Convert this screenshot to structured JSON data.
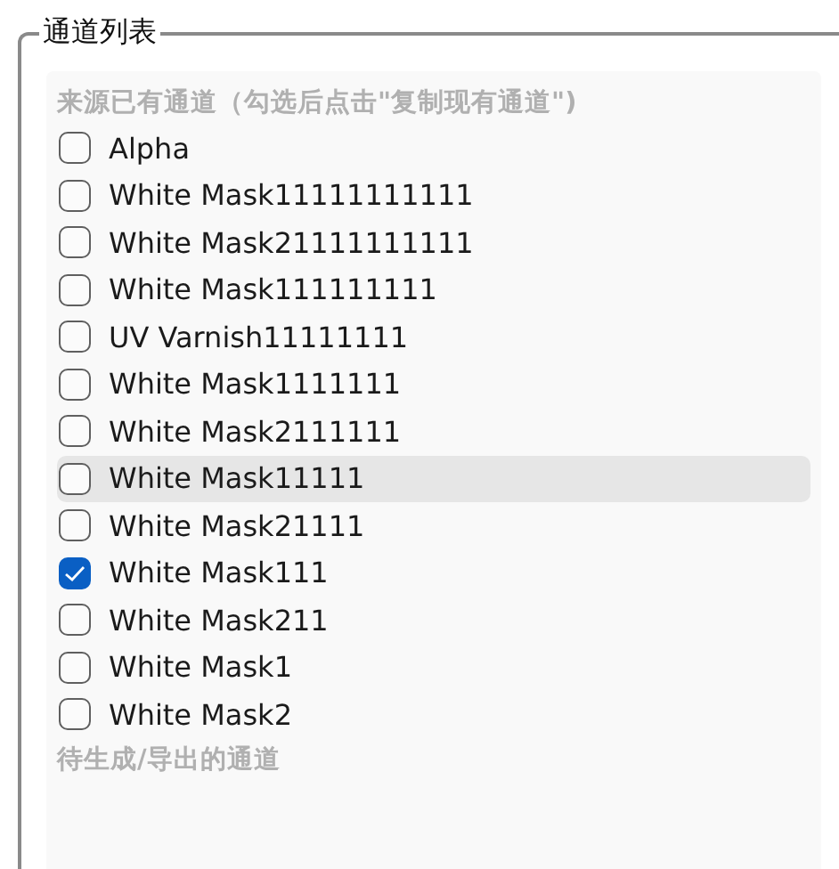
{
  "group": {
    "title": "通道列表"
  },
  "source_header": "来源已有通道（勾选后点击\"复制现有通道\")",
  "channels": [
    {
      "name": "Alpha",
      "checked": false,
      "hovered": false
    },
    {
      "name": "White Mask11111111111",
      "checked": false,
      "hovered": false
    },
    {
      "name": "White Mask21111111111",
      "checked": false,
      "hovered": false
    },
    {
      "name": "White Mask111111111",
      "checked": false,
      "hovered": false
    },
    {
      "name": "UV Varnish11111111",
      "checked": false,
      "hovered": false
    },
    {
      "name": "White Mask1111111",
      "checked": false,
      "hovered": false
    },
    {
      "name": "White Mask2111111",
      "checked": false,
      "hovered": false
    },
    {
      "name": "White Mask11111",
      "checked": false,
      "hovered": true
    },
    {
      "name": "White Mask21111",
      "checked": false,
      "hovered": false
    },
    {
      "name": "White Mask111",
      "checked": true,
      "hovered": false
    },
    {
      "name": "White Mask211",
      "checked": false,
      "hovered": false
    },
    {
      "name": "White Mask1",
      "checked": false,
      "hovered": false
    },
    {
      "name": "White Mask2",
      "checked": false,
      "hovered": false
    }
  ],
  "output_header": "待生成/导出的通道"
}
